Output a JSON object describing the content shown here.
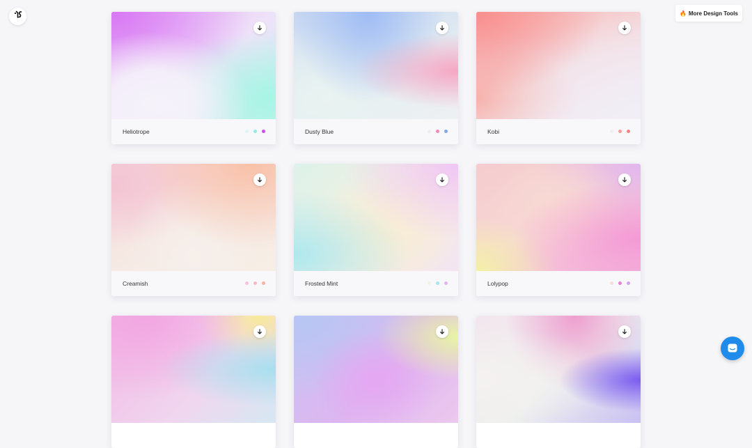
{
  "header": {
    "logo_icon": "brand-logo-icon",
    "tools_button_label": "More Design Tools",
    "tools_button_emoji": "🔥"
  },
  "cards": [
    {
      "name": "Heliotrope",
      "dots": [
        "#dff4f3",
        "#93eae0",
        "#c94fe6"
      ]
    },
    {
      "name": "Dusty Blue",
      "dots": [
        "#ebeef2",
        "#f28ab4",
        "#84a4ea"
      ]
    },
    {
      "name": "Kobi",
      "dots": [
        "#f0eef2",
        "#f19f9a",
        "#f2837c"
      ]
    },
    {
      "name": "Creamish",
      "dots": [
        "#f2c3dd",
        "#f5b8cb",
        "#f6b3a6"
      ]
    },
    {
      "name": "Frosted Mint",
      "dots": [
        "#f5f1e0",
        "#a6e6ec",
        "#e4b2f0"
      ]
    },
    {
      "name": "Lolypop",
      "dots": [
        "#f8dad7",
        "#ea81d2",
        "#d6a1ee"
      ]
    },
    {
      "name": "",
      "dots": []
    },
    {
      "name": "",
      "dots": []
    },
    {
      "name": "",
      "dots": []
    }
  ],
  "card_icons": {
    "download": "download-arrow-icon"
  },
  "chat_widget": {
    "icon": "chat-bubble-icon",
    "color": "#1f8ceb"
  }
}
